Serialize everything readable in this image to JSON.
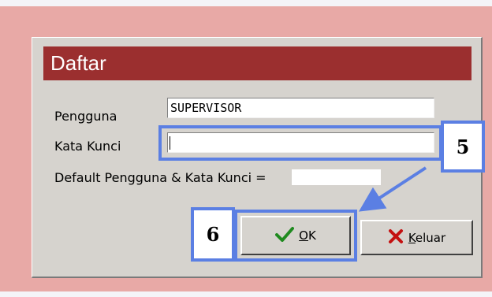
{
  "dialog": {
    "title": "Daftar",
    "user_label": "Pengguna",
    "user_value": "SUPERVISOR",
    "password_label": "Kata Kunci",
    "password_value": "",
    "default_label": "Default Pengguna & Kata Kunci =",
    "ok_label": "OK",
    "exit_label": "Keluar"
  },
  "annotations": {
    "step_password": "5",
    "step_ok": "6",
    "accent_color": "#5b7fe3"
  },
  "icons": {
    "ok": "checkmark-icon",
    "exit": "cross-icon"
  }
}
